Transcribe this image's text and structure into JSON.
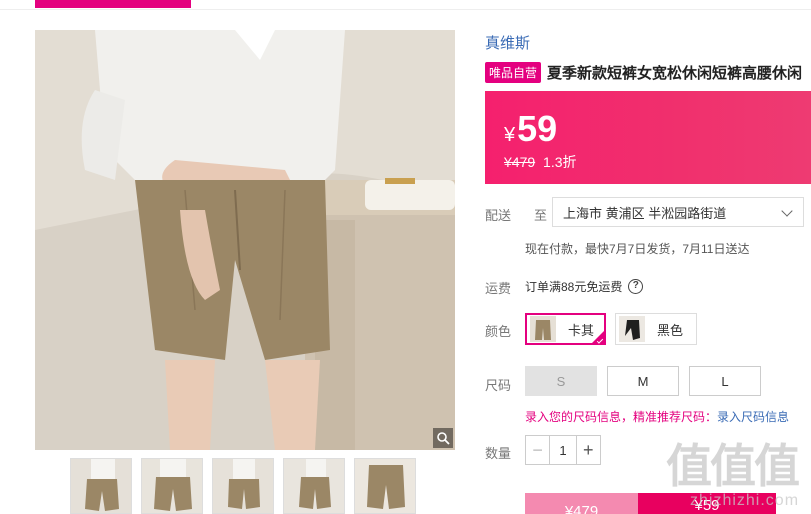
{
  "brand": "真维斯",
  "badge": "唯品自营",
  "title": "夏季新款短裤女宽松休闲短裤高腰休闲",
  "price": {
    "currency": "¥",
    "current": "59",
    "original": "¥479",
    "discount": "1.3折"
  },
  "delivery": {
    "label": "配送",
    "to": "至",
    "address": "上海市 黄浦区 半淞园路街道",
    "note": "现在付款，最快7月7日发货，7月11日送达"
  },
  "freight": {
    "label": "运费",
    "text": "订单满88元免运费",
    "help": "?"
  },
  "colors": {
    "label": "颜色",
    "options": [
      {
        "name": "卡其",
        "selected": true
      },
      {
        "name": "黑色",
        "selected": false
      }
    ]
  },
  "sizes": {
    "label": "尺码",
    "options": [
      {
        "name": "S",
        "available": false
      },
      {
        "name": "M",
        "available": true
      },
      {
        "name": "L",
        "available": true
      }
    ],
    "hint": "录入您的尺码信息，精准推荐尺码：",
    "hint_link": "录入尺码信息"
  },
  "quantity": {
    "label": "数量",
    "value": "1",
    "minus": "−",
    "plus": "+"
  },
  "buttons": {
    "original_price": "¥479",
    "buy_price": "¥59"
  },
  "watermark": {
    "logo": "值值值",
    "text": "zhizhizhi.com"
  },
  "colors_theme": {
    "accent": "#e4007f",
    "price_gradient_start": "#f5206e",
    "link": "#3a6bb5"
  },
  "icons": [
    "zoom-icon",
    "chevron-down-icon",
    "help-icon",
    "check-icon"
  ]
}
